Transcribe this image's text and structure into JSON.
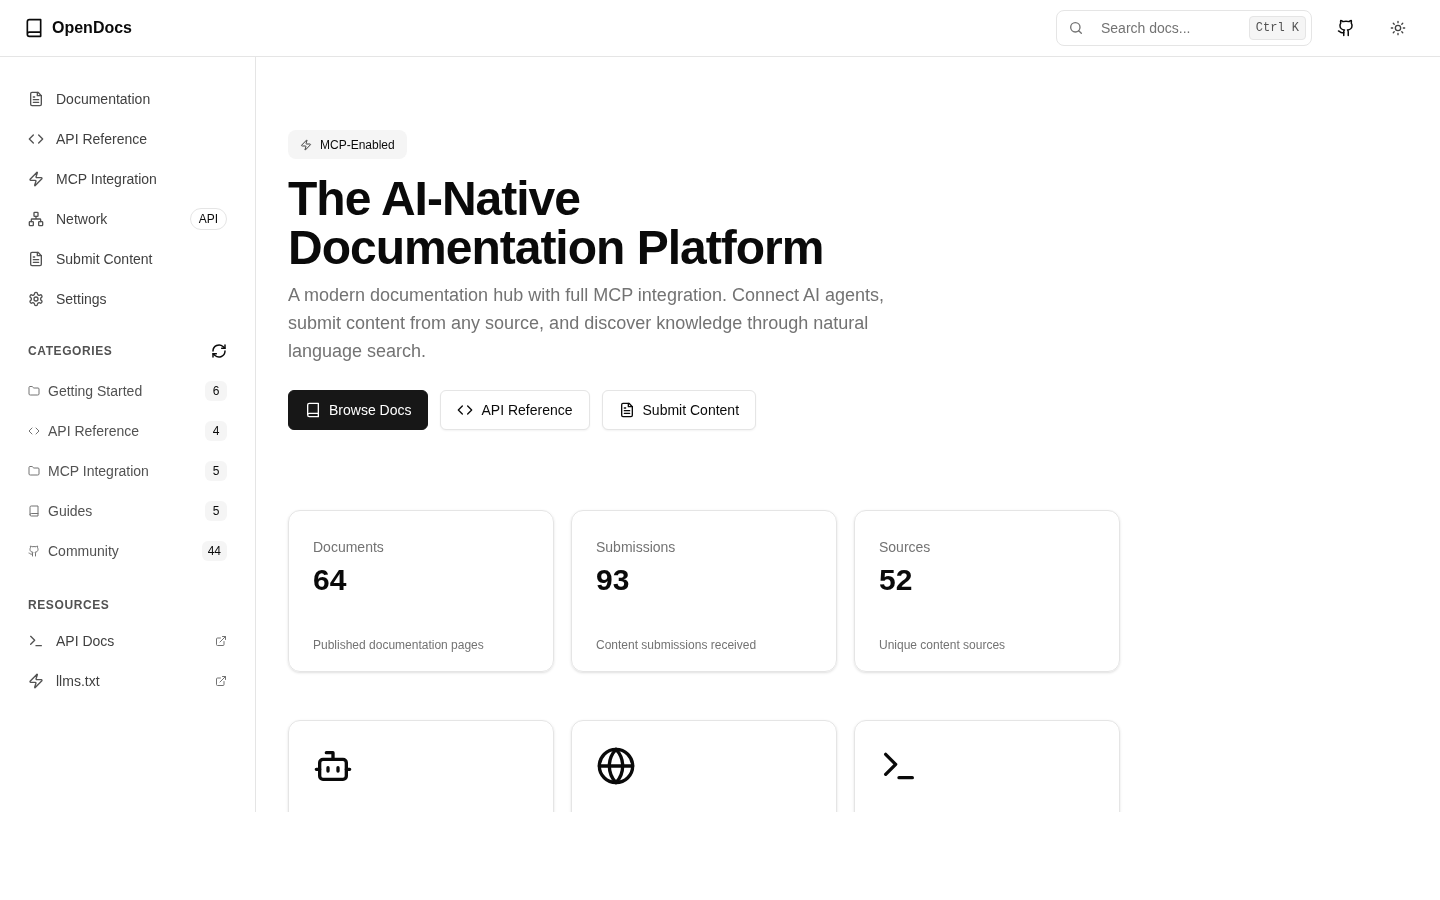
{
  "header": {
    "logo": "OpenDocs",
    "search": {
      "placeholder": "Search docs...",
      "shortcut": "Ctrl K"
    }
  },
  "sidebar": {
    "nav": [
      {
        "label": "Documentation"
      },
      {
        "label": "API Reference"
      },
      {
        "label": "MCP Integration"
      },
      {
        "label": "Network",
        "badge": "API"
      },
      {
        "label": "Submit Content"
      },
      {
        "label": "Settings"
      }
    ],
    "categories": {
      "title": "CATEGORIES",
      "items": [
        {
          "label": "Getting Started",
          "count": "6"
        },
        {
          "label": "API Reference",
          "count": "4"
        },
        {
          "label": "MCP Integration",
          "count": "5"
        },
        {
          "label": "Guides",
          "count": "5"
        },
        {
          "label": "Community",
          "count": "44"
        }
      ]
    },
    "resources": {
      "title": "RESOURCES",
      "items": [
        {
          "label": "API Docs"
        },
        {
          "label": "llms.txt"
        }
      ]
    }
  },
  "hero": {
    "badge": "MCP-Enabled",
    "title_lines": [
      "The AI-Native",
      "Documentation Platform"
    ],
    "description": "A modern documentation hub with full MCP integration. Connect AI agents, submit content from any source, and discover knowledge through natural language search.",
    "buttons": [
      {
        "label": "Browse Docs",
        "primary": true
      },
      {
        "label": "API Reference",
        "primary": false
      },
      {
        "label": "Submit Content",
        "primary": false
      }
    ]
  },
  "stats": [
    {
      "label": "Documents",
      "value": "64",
      "caption": "Published documentation pages"
    },
    {
      "label": "Submissions",
      "value": "93",
      "caption": "Content submissions received"
    },
    {
      "label": "Sources",
      "value": "52",
      "caption": "Unique content sources"
    }
  ]
}
